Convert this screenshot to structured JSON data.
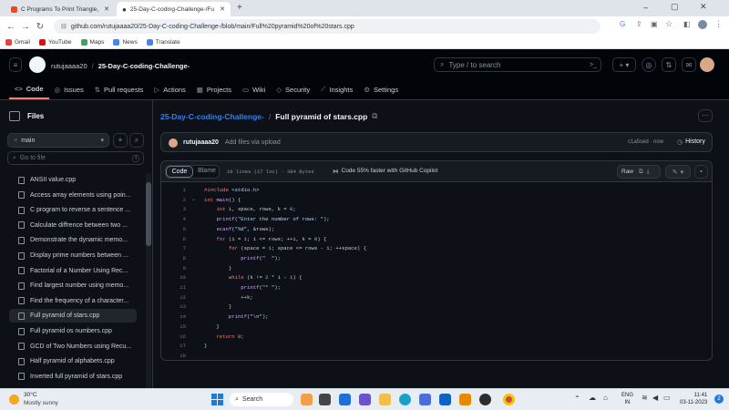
{
  "browser": {
    "tabs": [
      {
        "label": "C Programs To Print Triangle, Py"
      },
      {
        "label": "25-Day-C-coding-Challenge-/Fu"
      }
    ],
    "url": "github.com/rutujaaaa20/25-Day-C-coding-Challenge-/blob/main/Full%20pyramid%20of%20stars.cpp",
    "bookmarks": [
      {
        "label": "Gmail",
        "color": "#ea4335"
      },
      {
        "label": "YouTube",
        "color": "#ff0000"
      },
      {
        "label": "Maps",
        "color": "#34a853"
      },
      {
        "label": "News",
        "color": "#4285f4"
      },
      {
        "label": "Translate",
        "color": "#4285f4"
      }
    ]
  },
  "header": {
    "owner": "rutujaaaa20",
    "sep": "/",
    "repo": "25-Day-C-coding-Challenge-",
    "search_placeholder": "Type / to search",
    "plus": "+"
  },
  "repo_nav": [
    {
      "label": "Code",
      "icon": "<>"
    },
    {
      "label": "Issues",
      "icon": "◎"
    },
    {
      "label": "Pull requests",
      "icon": "⇅"
    },
    {
      "label": "Actions",
      "icon": "▷"
    },
    {
      "label": "Projects",
      "icon": "▦"
    },
    {
      "label": "Wiki",
      "icon": "▭"
    },
    {
      "label": "Security",
      "icon": "◇"
    },
    {
      "label": "Insights",
      "icon": "⟋"
    },
    {
      "label": "Settings",
      "icon": "⚙"
    }
  ],
  "sidebar": {
    "title": "Files",
    "branch": "main",
    "goto_placeholder": "Go to file",
    "goto_key": "t",
    "files": [
      "ANSII value.cpp",
      "Access array elements using poin...",
      "C program to reverse a sentence ...",
      "Calculate diffrence between two ...",
      "Demonstrate the dynamic memo...",
      "Display prime numbers between ...",
      "Factorial of a Number Using Rec...",
      "Find largest number using memo...",
      "Find the frequency of a character...",
      "Full pyramid of stars.cpp",
      "Full pyramid os numbers.cpp",
      "GCD of Two Numbers using Recu...",
      "Half pyramid of alphabets.cpp",
      "Inverted full pyramid of stars.cpp"
    ],
    "selected_index": 9
  },
  "file": {
    "repo_link": "25-Day-C-coding-Challenge-",
    "sep": "/",
    "name": "Full pyramid of stars.cpp",
    "commit_author": "rutujaaaa20",
    "commit_msg": "Add files via upload",
    "commit_hash": "c1a5ced · now",
    "history": "History",
    "tab_code": "Code",
    "tab_blame": "Blame",
    "stats": "18 lines (17 loc) · 384 Bytes",
    "copilot": "Code 55% faster with GitHub Copilot",
    "raw": "Raw"
  },
  "code_lines": [
    [
      [
        "pp",
        "#include "
      ],
      [
        "str",
        "<stdio.h>"
      ]
    ],
    [
      [
        "kw",
        "int "
      ],
      [
        "fn",
        "main"
      ],
      [
        "",
        "() {"
      ]
    ],
    [
      [
        "",
        "    "
      ],
      [
        "kw",
        "int "
      ],
      [
        "",
        "i, space, rows, k = "
      ],
      [
        "num",
        "0"
      ],
      [
        "",
        ";"
      ]
    ],
    [
      [
        "",
        "    "
      ],
      [
        "fn",
        "printf"
      ],
      [
        "",
        "("
      ],
      [
        "str",
        "\"Enter the number of rows: \""
      ],
      [
        "",
        ");"
      ]
    ],
    [
      [
        "",
        "    "
      ],
      [
        "fn",
        "scanf"
      ],
      [
        "",
        "("
      ],
      [
        "str",
        "\"%d\""
      ],
      [
        "",
        ", &rows);"
      ]
    ],
    [
      [
        "",
        "    "
      ],
      [
        "kw",
        "for "
      ],
      [
        "",
        "(i = "
      ],
      [
        "num",
        "1"
      ],
      [
        "",
        "; i <= rows; ++i, k = "
      ],
      [
        "num",
        "0"
      ],
      [
        "",
        ") {"
      ]
    ],
    [
      [
        "",
        "        "
      ],
      [
        "kw",
        "for "
      ],
      [
        "",
        "(space = "
      ],
      [
        "num",
        "1"
      ],
      [
        "",
        "; space <= rows - i; ++space) {"
      ]
    ],
    [
      [
        "",
        "            "
      ],
      [
        "fn",
        "printf"
      ],
      [
        "",
        "("
      ],
      [
        "str",
        "\"  \""
      ],
      [
        "",
        ");"
      ]
    ],
    [
      [
        "",
        "        }"
      ]
    ],
    [
      [
        "",
        "        "
      ],
      [
        "kw",
        "while "
      ],
      [
        "",
        "(k != "
      ],
      [
        "num",
        "2"
      ],
      [
        "",
        " * i - "
      ],
      [
        "num",
        "1"
      ],
      [
        "",
        ") {"
      ]
    ],
    [
      [
        "",
        "            "
      ],
      [
        "fn",
        "printf"
      ],
      [
        "",
        "("
      ],
      [
        "str",
        "\"* \""
      ],
      [
        "",
        ");"
      ]
    ],
    [
      [
        "",
        "            ++k;"
      ]
    ],
    [
      [
        "",
        "        }"
      ]
    ],
    [
      [
        "",
        "        "
      ],
      [
        "fn",
        "printf"
      ],
      [
        "",
        "("
      ],
      [
        "str",
        "\"\\n\""
      ],
      [
        "",
        ");"
      ]
    ],
    [
      [
        "",
        "    }"
      ]
    ],
    [
      [
        "",
        "    "
      ],
      [
        "kw",
        "return "
      ],
      [
        "num",
        "0"
      ],
      [
        "",
        ";"
      ]
    ],
    [
      [
        "",
        "}"
      ]
    ],
    [
      [
        "",
        ""
      ]
    ]
  ],
  "taskbar": {
    "weather_temp": "30°C",
    "weather_desc": "Mostly sunny",
    "search": "Search",
    "lang1": "ENG",
    "lang2": "IN",
    "time": "11:41",
    "date": "03-11-2023"
  }
}
